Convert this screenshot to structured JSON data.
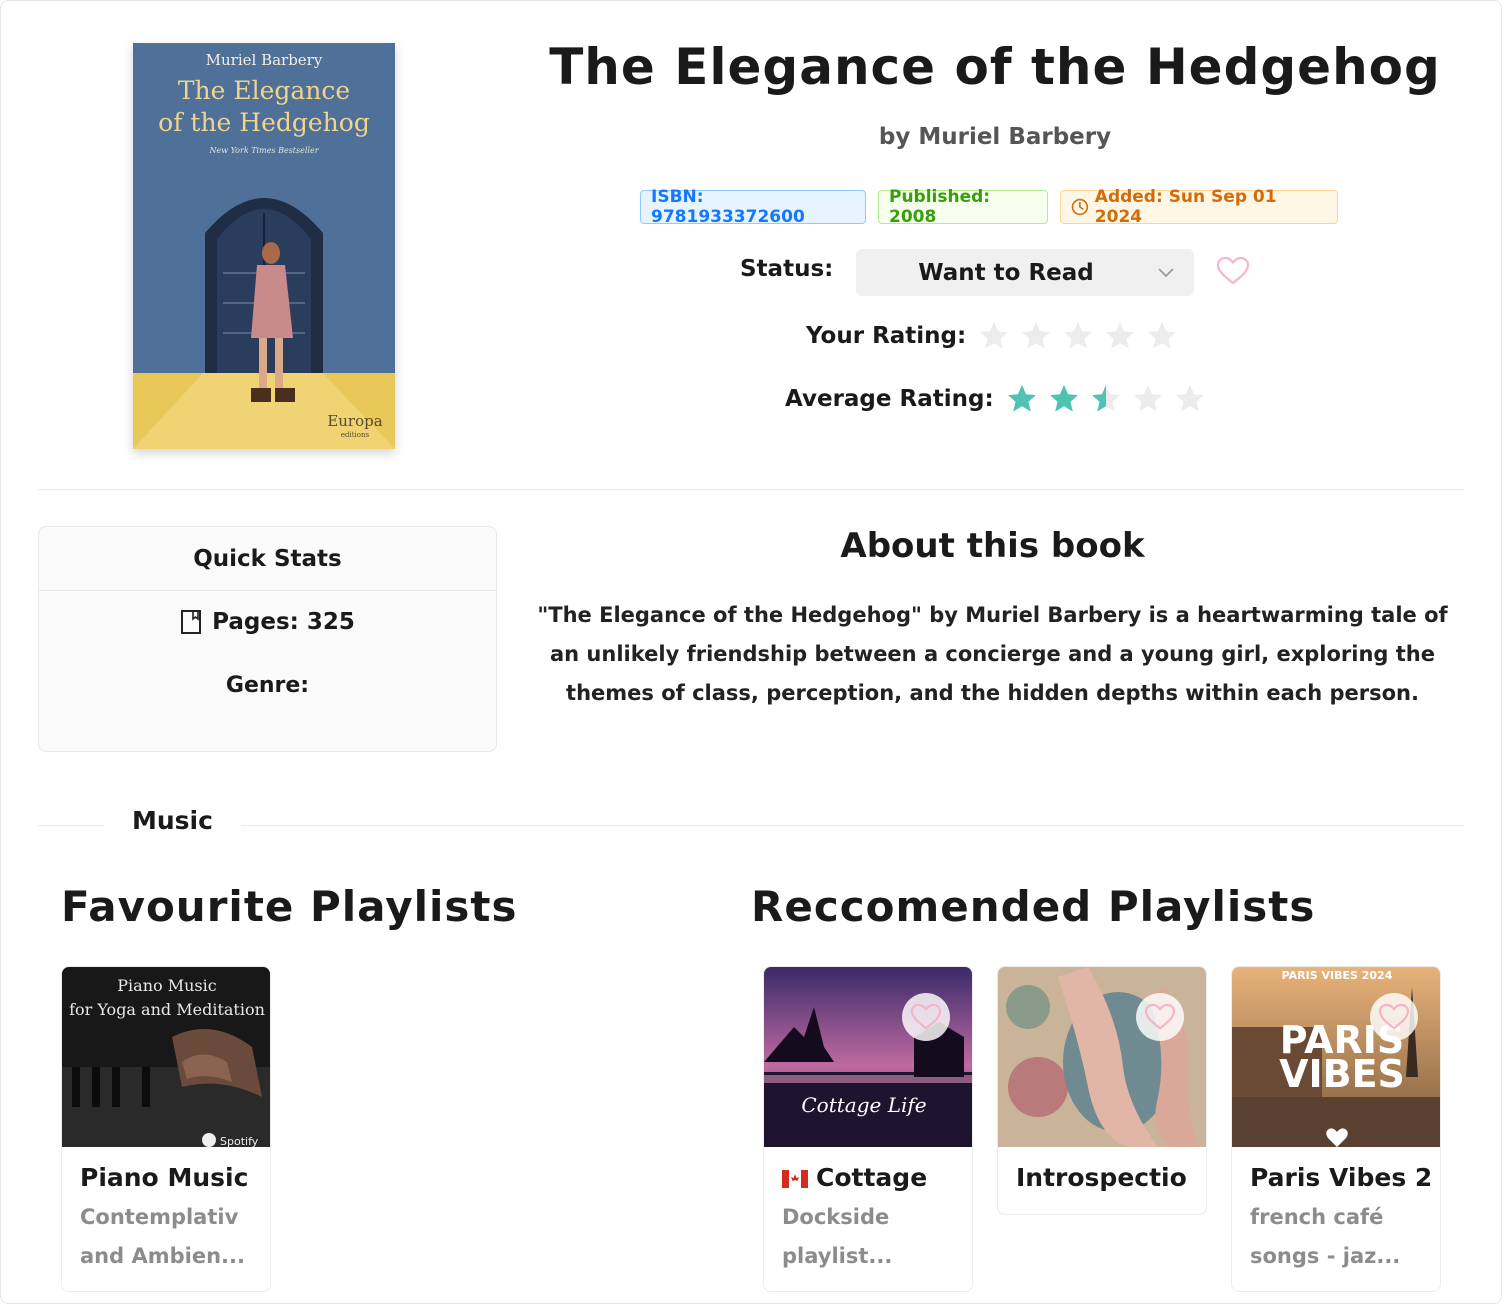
{
  "book": {
    "title": "The Elegance of the Hedgehog",
    "author_line": "by Muriel Barbery",
    "cover": {
      "author": "Muriel Barbery",
      "title_line1": "The Elegance",
      "title_line2": "of the Hedgehog",
      "tagline": "New York Times Bestseller",
      "publisher": "Europa",
      "publisher_sub": "editions"
    }
  },
  "badges": {
    "isbn": "ISBN: 9781933372600",
    "published": "Published: 2008",
    "added": "Added: Sun Sep 01 2024"
  },
  "status": {
    "label": "Status:",
    "value": "Want to Read"
  },
  "your_rating": {
    "label": "Your Rating:",
    "value": 0,
    "max": 5
  },
  "average_rating": {
    "label": "Average Rating:",
    "value": 2.5,
    "max": 5
  },
  "quick_stats": {
    "heading": "Quick Stats",
    "pages": "Pages: 325",
    "genre": "Genre:"
  },
  "about": {
    "heading": "About this book",
    "text": "\"The Elegance of the Hedgehog\" by Muriel Barbery is a heartwarming tale of an unlikely friendship between a concierge and a young girl, exploring the themes of class, perception, and the hidden depths within each person."
  },
  "music_label": "Music",
  "favourite": {
    "heading": "Favourite Playlists",
    "items": [
      {
        "title": "Piano Music",
        "desc1": "Contemplativ",
        "desc2": "and Ambien...",
        "art_line1": "Piano Music",
        "art_line2": "for Yoga and Meditation",
        "art_brand": "Spotify"
      }
    ]
  },
  "recommended": {
    "heading": "Reccomended Playlists",
    "items": [
      {
        "title": "Cottage",
        "desc1": "Dockside",
        "desc2": "playlist...",
        "art_text": "Cottage Life"
      },
      {
        "title": "Introspectio",
        "desc1": "",
        "desc2": ""
      },
      {
        "title": "Paris Vibes 2",
        "desc1": "french café",
        "desc2": "songs - jaz...",
        "art_top": "PARIS VIBES 2024",
        "art_big1": "PARIS",
        "art_big2": "VIBES"
      }
    ]
  },
  "colors": {
    "star_filled": "#4fc3b2",
    "star_empty": "#ececec",
    "heart_pink": "#f5b5c6",
    "isbn_blue": "#1677ff",
    "published_green": "#389e0d",
    "added_orange": "#d46b08"
  }
}
